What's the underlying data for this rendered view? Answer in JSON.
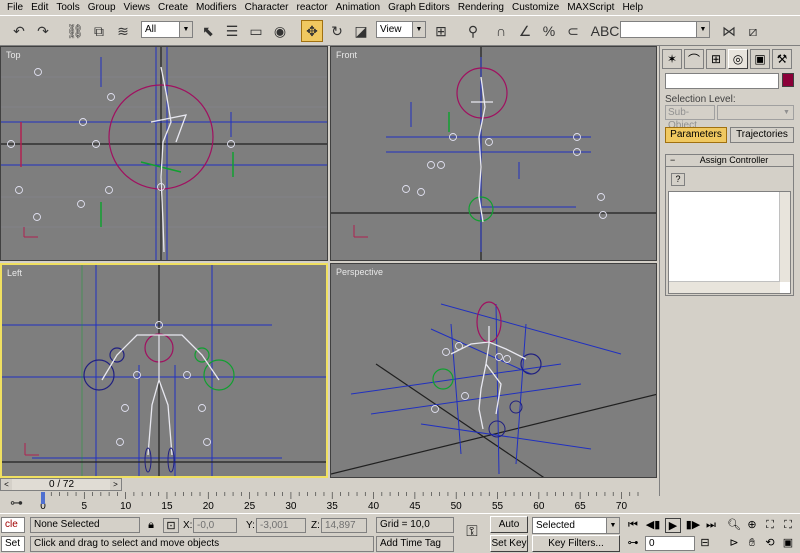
{
  "menu": [
    "File",
    "Edit",
    "Tools",
    "Group",
    "Views",
    "Create",
    "Modifiers",
    "Character",
    "reactor",
    "Animation",
    "Graph Editors",
    "Rendering",
    "Customize",
    "MAXScript",
    "Help"
  ],
  "toolbar": {
    "selection_filter": "All",
    "ref_coord": "View",
    "named_selection": ""
  },
  "viewports": {
    "top": "Top",
    "front": "Front",
    "left": "Left",
    "perspective": "Perspective"
  },
  "panel": {
    "object_name": "",
    "object_color": "#8b0038",
    "selection_level_label": "Selection Level:",
    "sub_object": "Sub-Object",
    "parameters": "Parameters",
    "trajectories": "Trajectories",
    "rollout_title": "Assign Controller",
    "rollout_help_icon": "?"
  },
  "timeline": {
    "frame_display": "0 / 72",
    "ticks": [
      "0",
      "5",
      "10",
      "15",
      "20",
      "25",
      "30",
      "35",
      "40",
      "45",
      "50",
      "55",
      "60",
      "65",
      "70"
    ]
  },
  "status": {
    "script_label_1": "cle",
    "script_label_2": "Set",
    "selection_info": "None Selected",
    "prompt": "Click and drag to select and move objects",
    "x_label": "X:",
    "x_value": "-0,0",
    "y_label": "Y:",
    "y_value": "-3,001",
    "z_label": "Z:",
    "z_value": "14,897",
    "grid": "Grid = 10,0",
    "add_time_tag": "Add Time Tag",
    "auto_key": "Auto Key",
    "set_key": "Set Key",
    "key_mode": "Selected",
    "key_filters": "Key Filters...",
    "current_frame": "0"
  },
  "colors": {
    "viewport_bg": "#7e7e7e",
    "active_border": "#f0e060",
    "button_active": "#f0c860"
  }
}
